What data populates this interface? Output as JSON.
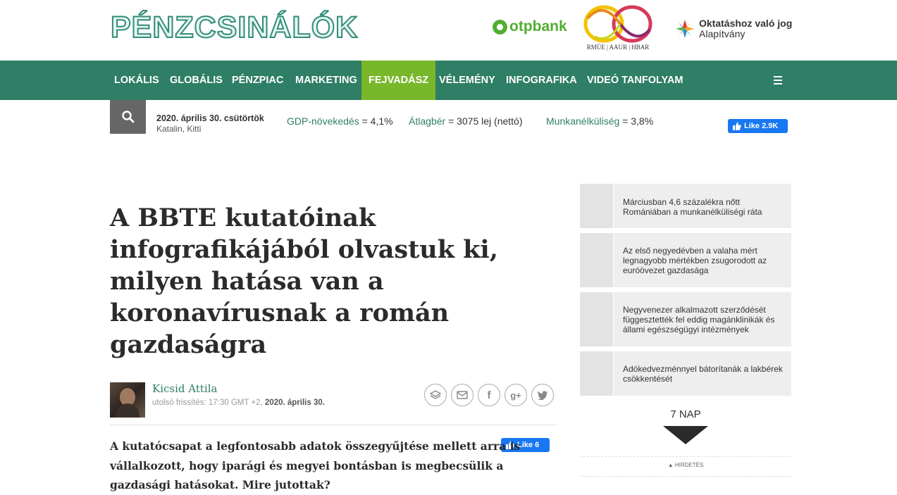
{
  "header": {
    "logo": "PÉNZCSINÁLÓK",
    "sponsor_otp": "otpbank",
    "sponsor_rmue_label": "RMÜE | AAUR | HBAR",
    "sponsor_okt_line1": "Oktatáshoz való jog",
    "sponsor_okt_line2": "Alapítvány"
  },
  "nav": {
    "items": [
      "LOKÁLIS",
      "GLOBÁLIS",
      "PÉNZPIAC",
      "MARKETING",
      "FEJVADÁSZ",
      "VÉLEMÉNY",
      "INFOGRAFIKA",
      "VIDEÓ TANFOLYAM"
    ],
    "active": "FEJVADÁSZ"
  },
  "infobar": {
    "date": "2020. április 30. csütörtök",
    "names": "Katalin, Kitti",
    "gdp_label": "GDP-növekedés",
    "gdp_value": " = 4,1%",
    "wage_label": "Átlagbér",
    "wage_value": " = 3075 lej (nettó)",
    "unemp_label": "Munkanélküliség",
    "unemp_value": " = 3,8%",
    "like_label": "Like 2.9K"
  },
  "article": {
    "title": "A BBTE kutatóinak infografikájából olvastuk ki, milyen hatása van a koronavírusnak a román gazdaságra",
    "author": "Kicsid Attila",
    "updated_prefix": "utolsó frissítés: 17:30 GMT +2, ",
    "updated_date": "2020. április 30.",
    "like_label": "Like 6",
    "lead": "A kutatócsapat a legfontosabb adatok összegyűjtése mellett arra is vállalkozott, hogy iparági és megyei bontásban is megbecsülik a gazdasági hatásokat. Mire jutottak?",
    "share_icons": [
      "layers-icon",
      "mail-icon",
      "facebook-icon",
      "google-plus-icon",
      "twitter-icon"
    ]
  },
  "sidebar": {
    "items": [
      {
        "text": "Márciusban 4,6 százalékra nőtt Romániában a munkanélküliségi ráta"
      },
      {
        "text": "Az első negyedévben a valaha mért legnagyobb mértékben zsugorodott az euróövezet gazdasága"
      },
      {
        "text": "Negyvenezer alkalmazott szerződését függesztették fel eddig magánklinikák és állami egészségügyi intézmények"
      },
      {
        "text": "Adókedvezménnyel bátorítanák a lakbérek csökkentését"
      }
    ],
    "week_label": "7 NAP",
    "ad_label": "▲ HIRDETÉS"
  },
  "colors": {
    "brand_green": "#2f7e66",
    "active_green": "#78b72a",
    "facebook_blue": "#1877f2"
  }
}
